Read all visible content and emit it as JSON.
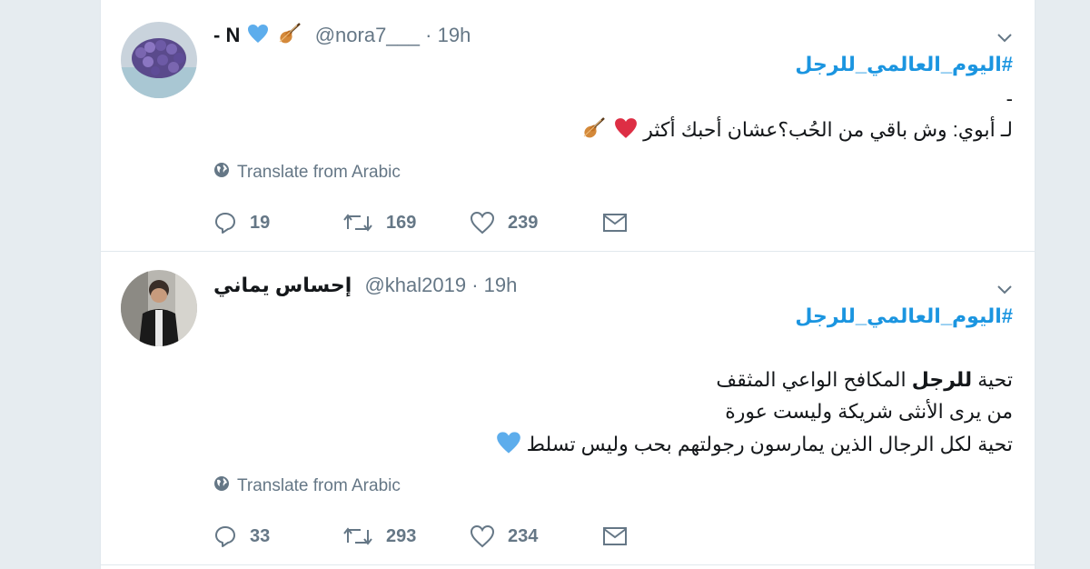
{
  "tweets": [
    {
      "display_name": "- N",
      "handle": "@nora7___",
      "dot": "·",
      "time": "19h",
      "hashtag": "#اليوم_العالمي_للرجل",
      "lines": [
        "-",
        "لـ أبوي: وش باقي من الحُب؟عشان أحبك أكثر"
      ],
      "translate": "Translate from Arabic",
      "replies": "19",
      "retweets": "169",
      "likes": "239"
    },
    {
      "display_name": "إحساس يماني",
      "handle": "@khal2019",
      "dot": "·",
      "time": "19h",
      "hashtag": "#اليوم_العالمي_للرجل",
      "line1_pre": "تحية ",
      "line1_bold": "للرجل",
      "line1_post": " المكافح الواعي المثقف",
      "line2": "من يرى الأنثى شريكة وليست عورة",
      "line3": "تحية لكل الرجال الذين يمارسون رجولتهم بحب وليس تسلط",
      "translate": "Translate from Arabic",
      "replies": "33",
      "retweets": "293",
      "likes": "234"
    }
  ],
  "icons": {
    "caret": "chevron-down-icon",
    "globe": "globe-icon",
    "reply": "reply-icon",
    "retweet": "retweet-icon",
    "like": "heart-icon",
    "dm": "envelope-icon"
  },
  "colors": {
    "link": "#1b95e0",
    "muted": "#657786",
    "blue_heart": "#5dadec",
    "red_heart": "#dd2e44"
  }
}
